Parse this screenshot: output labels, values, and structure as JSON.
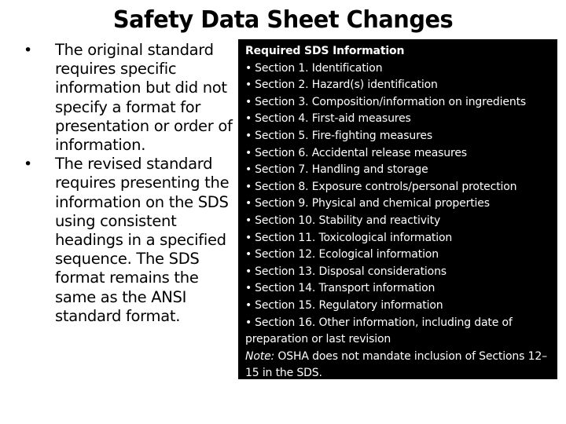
{
  "title": "Safety Data Sheet Changes",
  "left_bullets": [
    {
      "bullet_glyph": "•",
      "text": "The original standard requires specific information but did not specify a format for presentation or order of information."
    },
    {
      "bullet_glyph": "•",
      "text": "The revised standard requires presenting the information on the SDS using consistent headings in a specified sequence. The SDS format remains the same as the ANSI standard format."
    }
  ],
  "info_box": {
    "heading": "Required SDS Information",
    "bullet_glyph": "•",
    "items": [
      "Section 1. Identification",
      "Section 2. Hazard(s) identification",
      "Section 3. Composition/information on ingredients",
      "Section 4. First-aid measures",
      "Section 5. Fire-fighting measures",
      "Section 6. Accidental release measures",
      "Section 7. Handling and storage",
      "Section 8. Exposure controls/personal protection",
      "Section 9. Physical and chemical properties",
      "Section 10. Stability and reactivity",
      "Section 11. Toxicological information",
      "Section 12. Ecological information",
      "Section 13. Disposal considerations",
      "Section 14. Transport information",
      "Section 15. Regulatory information",
      "Section 16. Other information, including date of preparation or last revision"
    ],
    "note_label": "Note:",
    "note_text": " OSHA does not mandate inclusion of Sections 12–15 in the SDS."
  },
  "colors": {
    "background": "#ffffff",
    "box_background": "#000000",
    "box_text": "#ffffff",
    "text": "#000000"
  }
}
